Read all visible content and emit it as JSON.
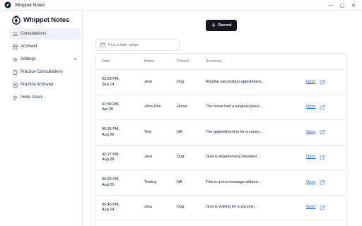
{
  "window": {
    "title": "Whippet Notes",
    "controls": [
      "—",
      "▢",
      "✕"
    ]
  },
  "brand": {
    "name": "Whippet Notes"
  },
  "sidebar": {
    "items": [
      {
        "label": "Consultations",
        "icon": "list-icon",
        "active": true
      },
      {
        "label": "Archived",
        "icon": "archive-icon",
        "active": false
      },
      {
        "label": "Settings",
        "icon": "gear-icon",
        "active": false,
        "expandable": true
      },
      {
        "label": "Practice Consultations",
        "icon": "clipboard-icon",
        "active": false
      },
      {
        "label": "Practice Archived",
        "icon": "archive-icon",
        "active": false
      },
      {
        "label": "Invite Users",
        "icon": "user-plus-icon",
        "active": false
      }
    ]
  },
  "toolbar": {
    "record_label": "Record"
  },
  "filter": {
    "date_placeholder": "Pick a date range"
  },
  "table": {
    "headers": {
      "date": "Date",
      "name": "Name",
      "patient": "Patient",
      "summary": "Summary"
    },
    "open_label": "Open",
    "rows": [
      {
        "date_line1": "02:28 PM,",
        "date_line2": "Sep 14",
        "name": "Jess",
        "patient": "Dog",
        "summary": "Routine vaccination appointmen..."
      },
      {
        "date_line1": "01:58 PM,",
        "date_line2": "Apr 30",
        "name": "John Doe",
        "patient": "Horse",
        "summary": "The horse had a surgical proce..."
      },
      {
        "date_line1": "06:36 PM,",
        "date_line2": "Aug 29",
        "name": "Test",
        "patient": "NA",
        "summary": "The appointment is for a consu..."
      },
      {
        "date_line1": "02:27 PM,",
        "date_line2": "Aug 28",
        "name": "Jess",
        "patient": "Dog",
        "summary": "Jess is experiencing elevated ..."
      },
      {
        "date_line1": "06:55 PM,",
        "date_line2": "Aug 25",
        "name": "Testing",
        "patient": "NA",
        "summary": "This is a test message without..."
      },
      {
        "date_line1": "05:45 PM,",
        "date_line2": "Aug 24",
        "name": "Jess",
        "patient": "Dog",
        "summary": "Jess is visiting for a vaccine..."
      }
    ]
  },
  "colors": {
    "accent_link": "#2563eb",
    "record_bg": "#15171c",
    "active_nav_bg": "#eef0f3",
    "border": "#e5e7eb"
  }
}
